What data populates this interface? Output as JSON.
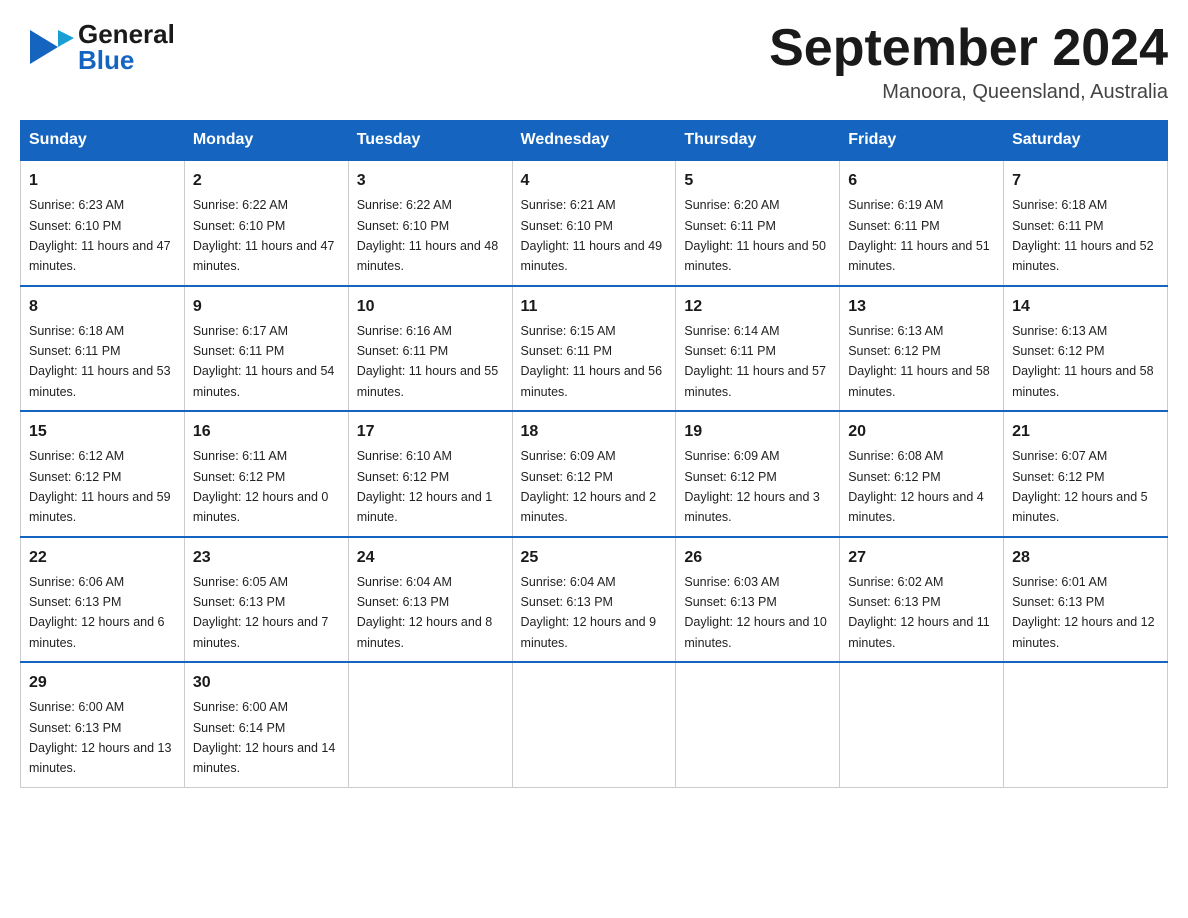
{
  "header": {
    "logo_line1": "General",
    "logo_line2": "Blue",
    "month_title": "September 2024",
    "location": "Manoora, Queensland, Australia"
  },
  "days_of_week": [
    "Sunday",
    "Monday",
    "Tuesday",
    "Wednesday",
    "Thursday",
    "Friday",
    "Saturday"
  ],
  "weeks": [
    [
      {
        "day": "1",
        "sunrise": "Sunrise: 6:23 AM",
        "sunset": "Sunset: 6:10 PM",
        "daylight": "Daylight: 11 hours and 47 minutes."
      },
      {
        "day": "2",
        "sunrise": "Sunrise: 6:22 AM",
        "sunset": "Sunset: 6:10 PM",
        "daylight": "Daylight: 11 hours and 47 minutes."
      },
      {
        "day": "3",
        "sunrise": "Sunrise: 6:22 AM",
        "sunset": "Sunset: 6:10 PM",
        "daylight": "Daylight: 11 hours and 48 minutes."
      },
      {
        "day": "4",
        "sunrise": "Sunrise: 6:21 AM",
        "sunset": "Sunset: 6:10 PM",
        "daylight": "Daylight: 11 hours and 49 minutes."
      },
      {
        "day": "5",
        "sunrise": "Sunrise: 6:20 AM",
        "sunset": "Sunset: 6:11 PM",
        "daylight": "Daylight: 11 hours and 50 minutes."
      },
      {
        "day": "6",
        "sunrise": "Sunrise: 6:19 AM",
        "sunset": "Sunset: 6:11 PM",
        "daylight": "Daylight: 11 hours and 51 minutes."
      },
      {
        "day": "7",
        "sunrise": "Sunrise: 6:18 AM",
        "sunset": "Sunset: 6:11 PM",
        "daylight": "Daylight: 11 hours and 52 minutes."
      }
    ],
    [
      {
        "day": "8",
        "sunrise": "Sunrise: 6:18 AM",
        "sunset": "Sunset: 6:11 PM",
        "daylight": "Daylight: 11 hours and 53 minutes."
      },
      {
        "day": "9",
        "sunrise": "Sunrise: 6:17 AM",
        "sunset": "Sunset: 6:11 PM",
        "daylight": "Daylight: 11 hours and 54 minutes."
      },
      {
        "day": "10",
        "sunrise": "Sunrise: 6:16 AM",
        "sunset": "Sunset: 6:11 PM",
        "daylight": "Daylight: 11 hours and 55 minutes."
      },
      {
        "day": "11",
        "sunrise": "Sunrise: 6:15 AM",
        "sunset": "Sunset: 6:11 PM",
        "daylight": "Daylight: 11 hours and 56 minutes."
      },
      {
        "day": "12",
        "sunrise": "Sunrise: 6:14 AM",
        "sunset": "Sunset: 6:11 PM",
        "daylight": "Daylight: 11 hours and 57 minutes."
      },
      {
        "day": "13",
        "sunrise": "Sunrise: 6:13 AM",
        "sunset": "Sunset: 6:12 PM",
        "daylight": "Daylight: 11 hours and 58 minutes."
      },
      {
        "day": "14",
        "sunrise": "Sunrise: 6:13 AM",
        "sunset": "Sunset: 6:12 PM",
        "daylight": "Daylight: 11 hours and 58 minutes."
      }
    ],
    [
      {
        "day": "15",
        "sunrise": "Sunrise: 6:12 AM",
        "sunset": "Sunset: 6:12 PM",
        "daylight": "Daylight: 11 hours and 59 minutes."
      },
      {
        "day": "16",
        "sunrise": "Sunrise: 6:11 AM",
        "sunset": "Sunset: 6:12 PM",
        "daylight": "Daylight: 12 hours and 0 minutes."
      },
      {
        "day": "17",
        "sunrise": "Sunrise: 6:10 AM",
        "sunset": "Sunset: 6:12 PM",
        "daylight": "Daylight: 12 hours and 1 minute."
      },
      {
        "day": "18",
        "sunrise": "Sunrise: 6:09 AM",
        "sunset": "Sunset: 6:12 PM",
        "daylight": "Daylight: 12 hours and 2 minutes."
      },
      {
        "day": "19",
        "sunrise": "Sunrise: 6:09 AM",
        "sunset": "Sunset: 6:12 PM",
        "daylight": "Daylight: 12 hours and 3 minutes."
      },
      {
        "day": "20",
        "sunrise": "Sunrise: 6:08 AM",
        "sunset": "Sunset: 6:12 PM",
        "daylight": "Daylight: 12 hours and 4 minutes."
      },
      {
        "day": "21",
        "sunrise": "Sunrise: 6:07 AM",
        "sunset": "Sunset: 6:12 PM",
        "daylight": "Daylight: 12 hours and 5 minutes."
      }
    ],
    [
      {
        "day": "22",
        "sunrise": "Sunrise: 6:06 AM",
        "sunset": "Sunset: 6:13 PM",
        "daylight": "Daylight: 12 hours and 6 minutes."
      },
      {
        "day": "23",
        "sunrise": "Sunrise: 6:05 AM",
        "sunset": "Sunset: 6:13 PM",
        "daylight": "Daylight: 12 hours and 7 minutes."
      },
      {
        "day": "24",
        "sunrise": "Sunrise: 6:04 AM",
        "sunset": "Sunset: 6:13 PM",
        "daylight": "Daylight: 12 hours and 8 minutes."
      },
      {
        "day": "25",
        "sunrise": "Sunrise: 6:04 AM",
        "sunset": "Sunset: 6:13 PM",
        "daylight": "Daylight: 12 hours and 9 minutes."
      },
      {
        "day": "26",
        "sunrise": "Sunrise: 6:03 AM",
        "sunset": "Sunset: 6:13 PM",
        "daylight": "Daylight: 12 hours and 10 minutes."
      },
      {
        "day": "27",
        "sunrise": "Sunrise: 6:02 AM",
        "sunset": "Sunset: 6:13 PM",
        "daylight": "Daylight: 12 hours and 11 minutes."
      },
      {
        "day": "28",
        "sunrise": "Sunrise: 6:01 AM",
        "sunset": "Sunset: 6:13 PM",
        "daylight": "Daylight: 12 hours and 12 minutes."
      }
    ],
    [
      {
        "day": "29",
        "sunrise": "Sunrise: 6:00 AM",
        "sunset": "Sunset: 6:13 PM",
        "daylight": "Daylight: 12 hours and 13 minutes."
      },
      {
        "day": "30",
        "sunrise": "Sunrise: 6:00 AM",
        "sunset": "Sunset: 6:14 PM",
        "daylight": "Daylight: 12 hours and 14 minutes."
      },
      null,
      null,
      null,
      null,
      null
    ]
  ]
}
